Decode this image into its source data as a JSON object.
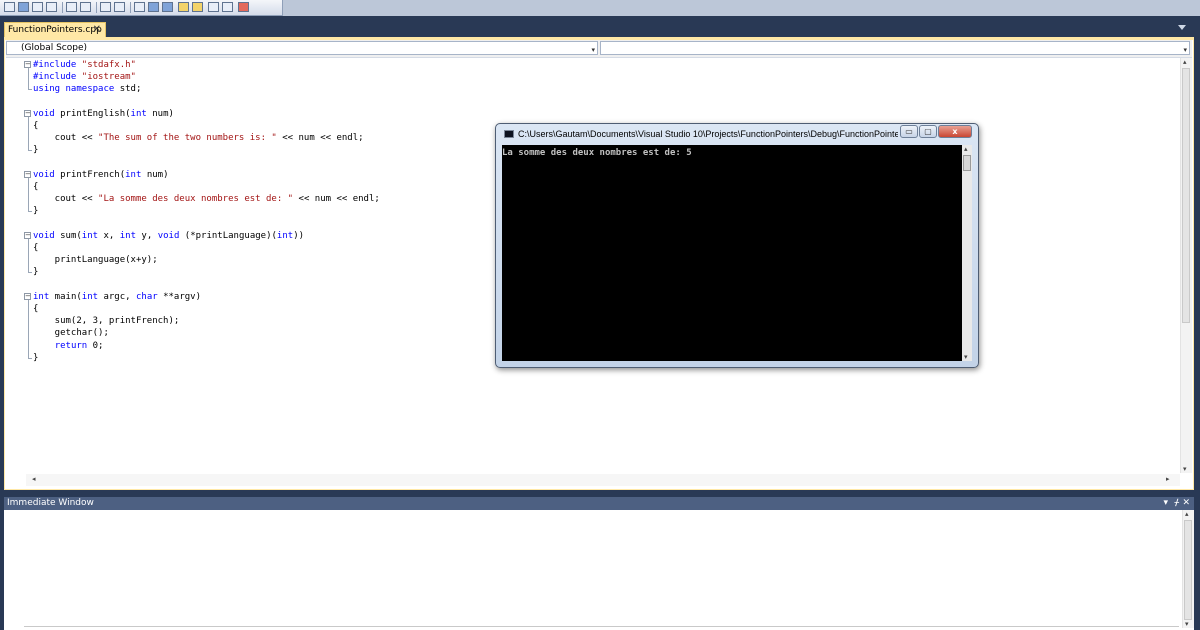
{
  "toolbar": {
    "buttons": [
      "new-item-icon",
      "add-item-icon",
      "select-icon",
      "font-icon",
      "indent-icon",
      "outdent-icon",
      "comment-icon",
      "uncomment-icon",
      "bookmark-icon",
      "prev-bookmark-icon",
      "next-bookmark-icon",
      "folder-prev-icon",
      "folder-next-icon",
      "file-prev-icon",
      "file-next-icon",
      "clear-bookmarks-icon"
    ]
  },
  "editor": {
    "tab_label": "FunctionPointers.cpp",
    "tab_close": "✕",
    "scope_label": "(Global Scope)",
    "code_lines": [
      "#include \"stdafx.h\"",
      "#include \"iostream\"",
      "using namespace std;",
      "",
      "void printEnglish(int num)",
      "{",
      "    cout << \"The sum of the two numbers is: \" << num << endl;",
      "}",
      "",
      "void printFrench(int num)",
      "{",
      "    cout << \"La somme des deux nombres est de: \" << num << endl;",
      "}",
      "",
      "void sum(int x, int y, void (*printLanguage)(int))",
      "{",
      "    printLanguage(x+y);",
      "}",
      "",
      "int main(int argc, char **argv)",
      "{",
      "    sum(2, 3, printFrench);",
      "    getchar();",
      "    return 0;",
      "}"
    ]
  },
  "console": {
    "title": "C:\\Users\\Gautam\\Documents\\Visual Studio 10\\Projects\\FunctionPointers\\Debug\\FunctionPointers....",
    "output": "La somme des deux nombres est de: 5",
    "minimize": "▭",
    "maximize": "▢",
    "close": "x"
  },
  "immediate": {
    "title": "Immediate Window",
    "dropdown": "▾",
    "pin": "ᚋ",
    "close": "✕"
  },
  "colors": {
    "chrome_bg": "#293955",
    "tab_active": "#ffe8a6",
    "keyword": "#0000ff",
    "string": "#a31515"
  }
}
